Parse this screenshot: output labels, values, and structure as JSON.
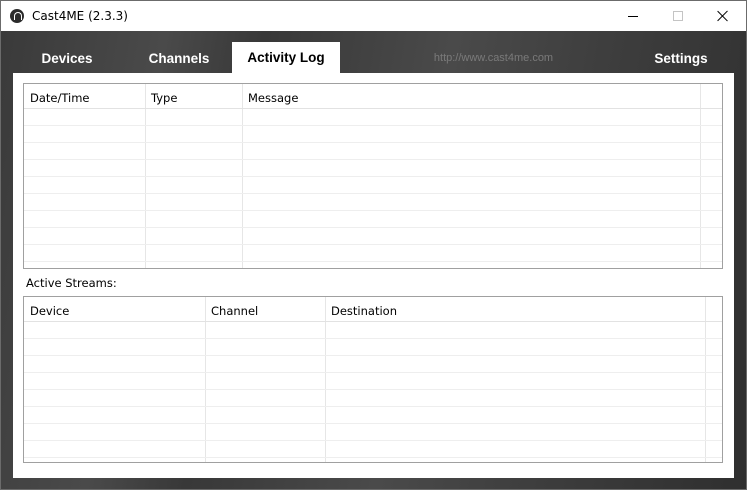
{
  "window": {
    "title": "Cast4ME (2.3.3)"
  },
  "tabs": {
    "devices": "Devices",
    "channels": "Channels",
    "activity_log": "Activity Log",
    "url": "http://www.cast4me.com",
    "settings": "Settings"
  },
  "activity_log": {
    "columns": [
      "Date/Time",
      "Type",
      "Message"
    ],
    "rows": []
  },
  "active_streams": {
    "label": "Active Streams:",
    "columns": [
      "Device",
      "Channel",
      "Destination"
    ],
    "rows": []
  },
  "icons": {
    "app": "cast4me-app-icon",
    "minimize": "minimize-icon",
    "maximize": "maximize-icon",
    "close": "close-icon"
  }
}
